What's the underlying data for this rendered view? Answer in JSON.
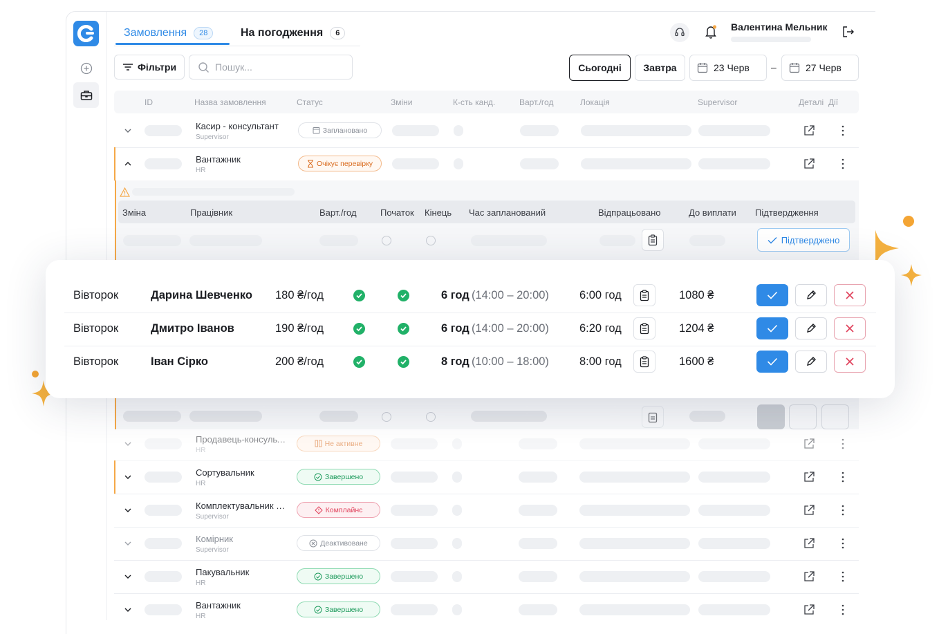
{
  "tabs": [
    {
      "label": "Замовлення",
      "count": "28"
    },
    {
      "label": "На погодження",
      "count": "6"
    }
  ],
  "user": {
    "name": "Валентина Мельник"
  },
  "toolbar": {
    "filters": "Фільтри",
    "search_placeholder": "Пошук...",
    "today": "Сьогодні",
    "tomorrow": "Завтра",
    "date_from": "23 Черв",
    "date_sep": "–",
    "date_to": "27 Черв"
  },
  "columns": [
    "ID",
    "Назва замовлення",
    "Статус",
    "Зміни",
    "К-сть канд.",
    "Варт./год",
    "Локація",
    "Supervisor",
    "Деталі",
    "Дії"
  ],
  "orders_top": [
    {
      "name": "Касир - консультант",
      "sub": "Supervisor",
      "status": "Заплановано",
      "status_kind": "planned"
    },
    {
      "name": "Вантажник",
      "sub": "HR",
      "status": "Очікує перевірку",
      "status_kind": "pending"
    }
  ],
  "subtable": {
    "columns": [
      "Зміна",
      "Працівник",
      "Варт./год",
      "Початок",
      "Кінець",
      "Час запланований",
      "Відпрацьовано",
      "До виплати",
      "Підтвердження"
    ],
    "confirmed": "Підтверджено"
  },
  "shifts": [
    {
      "day": "Вівторок",
      "worker": "Дарина Шевченко",
      "rate": "180 ₴/год",
      "hours": "6 год",
      "time": "(14:00 – 20:00)",
      "worked": "6:00 год",
      "pay": "1080 ₴"
    },
    {
      "day": "Вівторок",
      "worker": "Дмитро Іванов",
      "rate": "190 ₴/год",
      "hours": "6 год",
      "time": "(14:00 – 20:00)",
      "worked": "6:20 год",
      "pay": "1204 ₴"
    },
    {
      "day": "Вівторок",
      "worker": "Іван Сірко",
      "rate": "200 ₴/год",
      "hours": "8 год",
      "time": "(10:00 – 18:00)",
      "worked": "8:00 год",
      "pay": "1600 ₴"
    }
  ],
  "orders_bottom": [
    {
      "name": "Продавець-консультант",
      "sub": "HR",
      "status": "Не активне",
      "status_kind": "inactive"
    },
    {
      "name": "Сортувальник",
      "sub": "HR",
      "status": "Завершено",
      "status_kind": "done"
    },
    {
      "name": "Комплектувальник замовлень",
      "sub": "Supervisor",
      "status": "Комплайнс",
      "status_kind": "compliance"
    },
    {
      "name": "Комірник",
      "sub": "Supervisor",
      "status": "Деактивоване",
      "status_kind": "deactivated"
    },
    {
      "name": "Пакувальник",
      "sub": "HR",
      "status": "Завершено",
      "status_kind": "done"
    },
    {
      "name": "Вантажник",
      "sub": "HR",
      "status": "Завершено",
      "status_kind": "done"
    }
  ],
  "colors": {
    "accent": "#2f8ae6",
    "success": "#21b168",
    "warning": "#f5a847",
    "danger": "#e0415b"
  }
}
